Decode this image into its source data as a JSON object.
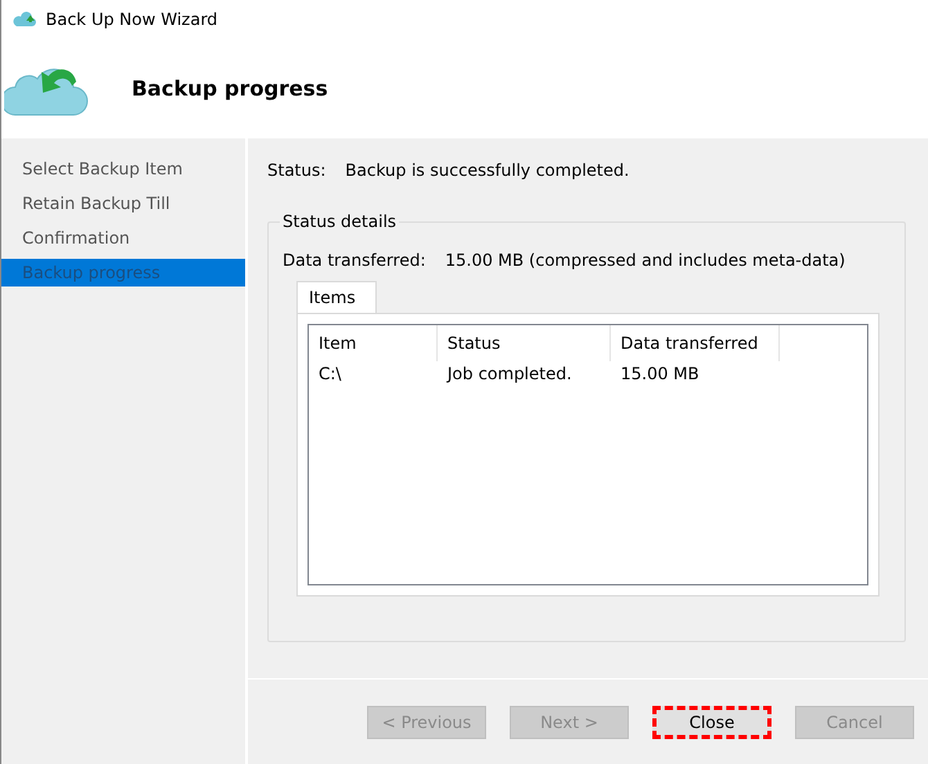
{
  "window": {
    "title": "Back Up Now Wizard"
  },
  "header": {
    "title": "Backup progress"
  },
  "steps": [
    {
      "label": "Select Backup Item",
      "selected": false
    },
    {
      "label": "Retain Backup Till",
      "selected": false
    },
    {
      "label": "Confirmation",
      "selected": false
    },
    {
      "label": "Backup progress",
      "selected": true
    }
  ],
  "status": {
    "label": "Status:",
    "value": "Backup is successfully completed."
  },
  "status_details": {
    "title": "Status details",
    "data_label": "Data transferred:",
    "data_value": "15.00 MB (compressed and includes meta-data)",
    "tabs": [
      {
        "label": "Items",
        "selected": true
      }
    ],
    "table": {
      "columns": [
        "Item",
        "Status",
        "Data transferred"
      ],
      "rows": [
        [
          "C:\\",
          "Job completed.",
          "15.00 MB"
        ]
      ]
    }
  },
  "buttons": [
    {
      "label": "< Previous",
      "disabled": true,
      "highlighted": false
    },
    {
      "label": "Next >",
      "disabled": true,
      "highlighted": false
    },
    {
      "label": "Close",
      "disabled": false,
      "highlighted": true
    },
    {
      "label": "Cancel",
      "disabled": true,
      "highlighted": false
    }
  ]
}
